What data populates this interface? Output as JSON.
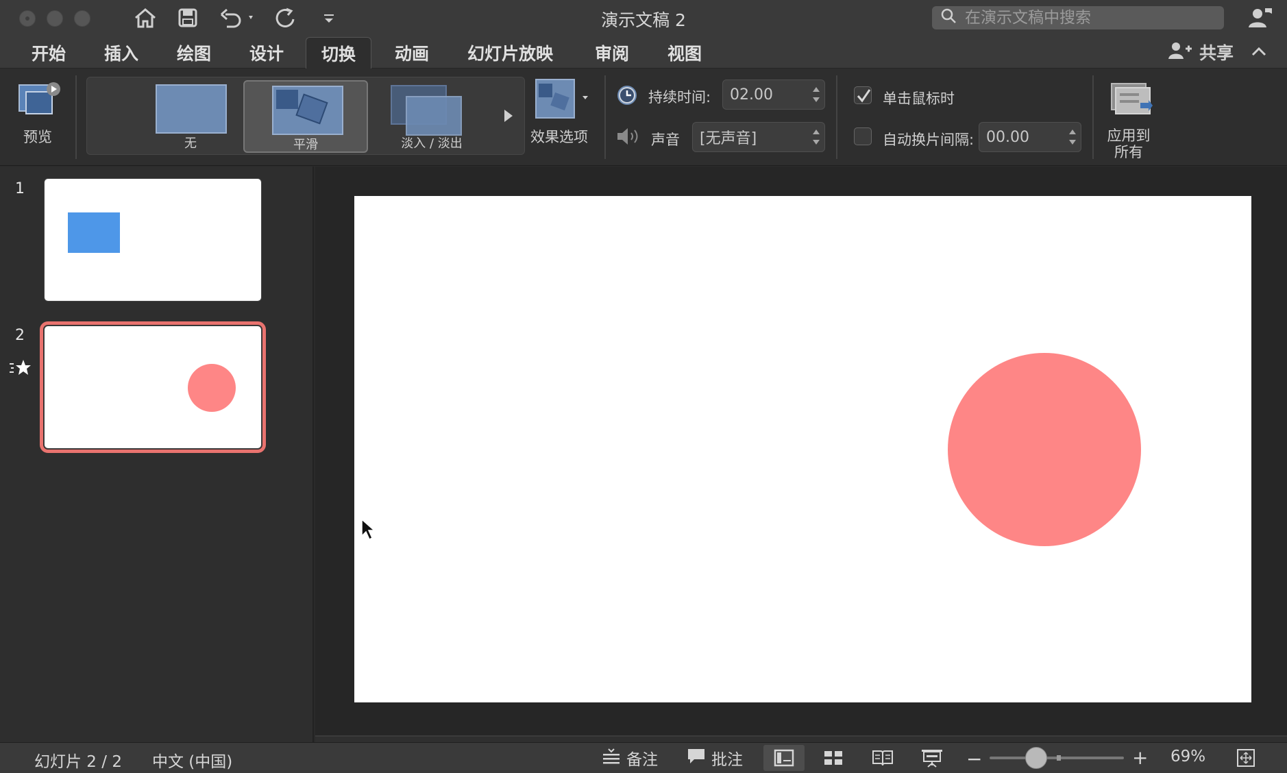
{
  "window": {
    "title": "演示文稿 2"
  },
  "search": {
    "placeholder": "在演示文稿中搜索"
  },
  "tabs": [
    {
      "label": "开始"
    },
    {
      "label": "插入"
    },
    {
      "label": "绘图"
    },
    {
      "label": "设计"
    },
    {
      "label": "切换",
      "active": true
    },
    {
      "label": "动画"
    },
    {
      "label": "幻灯片放映"
    },
    {
      "label": "审阅"
    },
    {
      "label": "视图"
    }
  ],
  "share": {
    "label": "共享"
  },
  "ribbon": {
    "preview_label": "预览",
    "transitions": [
      {
        "label": "无"
      },
      {
        "label": "平滑",
        "selected": true
      },
      {
        "label": "淡入 / 淡出"
      }
    ],
    "effects_label": "效果选项",
    "duration_label": "持续时间:",
    "duration_value": "02.00",
    "sound_label": "声音",
    "sound_value": "[无声音]",
    "on_click_label": "单击鼠标时",
    "on_click_checked": true,
    "auto_label": "自动换片间隔:",
    "auto_checked": false,
    "auto_value": "00.00",
    "apply_all_line1": "应用到",
    "apply_all_line2": "所有"
  },
  "slides": [
    {
      "number": "1",
      "shape": "rectangle",
      "shape_color": "#4e97e8"
    },
    {
      "number": "2",
      "shape": "circle",
      "shape_color": "#fe8686",
      "selected": true,
      "has_transition_icon": true
    }
  ],
  "statusbar": {
    "slide_info": "幻灯片 2 / 2",
    "language": "中文 (中国)",
    "notes_label": "备注",
    "comments_label": "批注",
    "zoom_value": "69%",
    "zoom_minus": "−",
    "zoom_plus": "+"
  },
  "colors": {
    "accent_selected": "#e9736f",
    "circle": "#fe8686",
    "rectangle": "#4e97e8"
  }
}
